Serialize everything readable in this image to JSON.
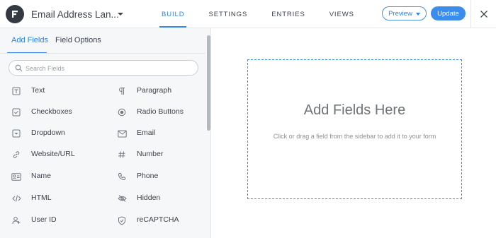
{
  "header": {
    "form_title": "Email Address Lan...",
    "nav": [
      {
        "label": "BUILD",
        "active": true
      },
      {
        "label": "SETTINGS",
        "active": false
      },
      {
        "label": "ENTRIES",
        "active": false
      },
      {
        "label": "VIEWS",
        "active": false
      }
    ],
    "preview_label": "Preview",
    "update_label": "Update",
    "accent_color": "#3b8ced"
  },
  "sidebar": {
    "tabs": [
      {
        "label": "Add Fields",
        "active": true
      },
      {
        "label": "Field Options",
        "active": false
      }
    ],
    "search": {
      "placeholder": "Search Fields",
      "value": ""
    },
    "fields": [
      {
        "label": "Text",
        "icon": "text-icon"
      },
      {
        "label": "Paragraph",
        "icon": "paragraph-icon"
      },
      {
        "label": "Checkboxes",
        "icon": "checkbox-icon"
      },
      {
        "label": "Radio Buttons",
        "icon": "radio-icon"
      },
      {
        "label": "Dropdown",
        "icon": "dropdown-icon"
      },
      {
        "label": "Email",
        "icon": "email-icon"
      },
      {
        "label": "Website/URL",
        "icon": "link-icon"
      },
      {
        "label": "Number",
        "icon": "hash-icon"
      },
      {
        "label": "Name",
        "icon": "name-card-icon"
      },
      {
        "label": "Phone",
        "icon": "phone-icon"
      },
      {
        "label": "HTML",
        "icon": "code-icon"
      },
      {
        "label": "Hidden",
        "icon": "eye-slash-icon"
      },
      {
        "label": "User ID",
        "icon": "user-icon"
      },
      {
        "label": "reCAPTCHA",
        "icon": "shield-icon"
      }
    ]
  },
  "canvas": {
    "title": "Add Fields Here",
    "subtitle": "Click or drag a field from the sidebar to add it to your form"
  }
}
